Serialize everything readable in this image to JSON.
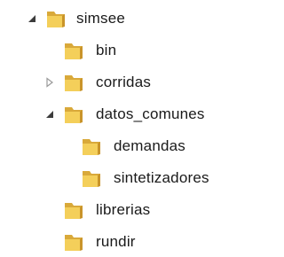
{
  "tree": {
    "nodes": [
      {
        "label": "simsee",
        "state": "expanded",
        "level": 0
      },
      {
        "label": "bin",
        "state": "leaf",
        "level": 1
      },
      {
        "label": "corridas",
        "state": "collapsed",
        "level": 1
      },
      {
        "label": "datos_comunes",
        "state": "expanded",
        "level": 1
      },
      {
        "label": "demandas",
        "state": "leaf",
        "level": 2
      },
      {
        "label": "sintetizadores",
        "state": "leaf",
        "level": 2
      },
      {
        "label": "librerias",
        "state": "leaf",
        "level": 1
      },
      {
        "label": "rundir",
        "state": "leaf",
        "level": 1
      }
    ]
  },
  "colors": {
    "folder_back": "#d9a93a",
    "folder_front": "#f4cf5a",
    "expander_filled": "#3c3c3c",
    "expander_outline": "#9a9a9a",
    "text": "#1a1a1a"
  },
  "icons": {
    "expanded": "expanded-triangle-icon",
    "collapsed": "collapsed-triangle-icon",
    "folder": "folder-icon"
  }
}
